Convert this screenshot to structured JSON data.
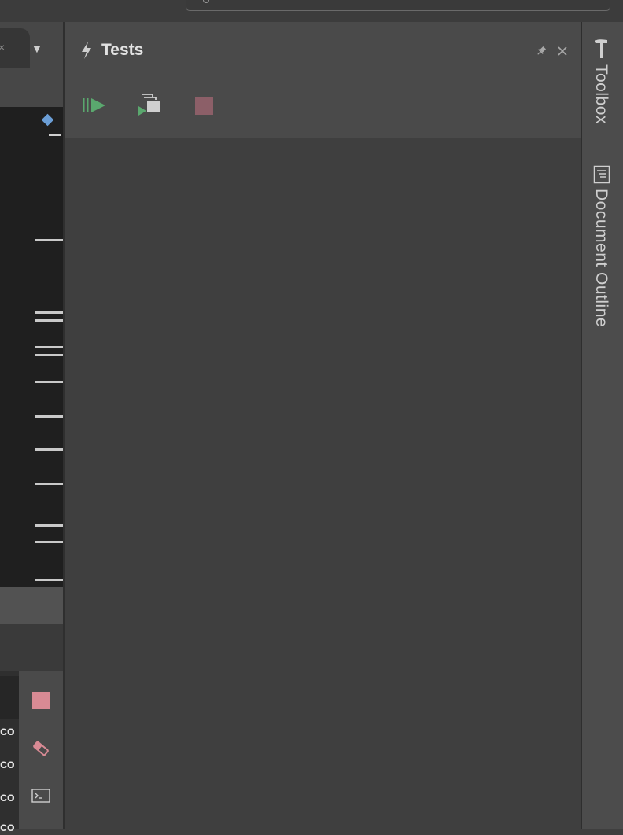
{
  "tests_panel": {
    "title": "Tests",
    "toolbar": {
      "run_all_icon": "run-all-tests-icon",
      "run_selected_icon": "run-selected-tests-icon",
      "stop_icon": "stop-icon"
    },
    "header_icons": [
      "pin-icon",
      "close-icon"
    ]
  },
  "right_toolbar": {
    "items": [
      {
        "label": "Toolbox",
        "icon": "hammer-icon"
      },
      {
        "label": "Document Outline",
        "icon": "document-outline-icon"
      }
    ]
  },
  "console": {
    "lines": [
      "co",
      "co",
      "co",
      "co"
    ]
  },
  "colors": {
    "run_green": "#5aa86e",
    "stop_console": "#d88a94",
    "stop_disabled": "#8c5f68",
    "marker_blue": "#6b9ed6"
  }
}
